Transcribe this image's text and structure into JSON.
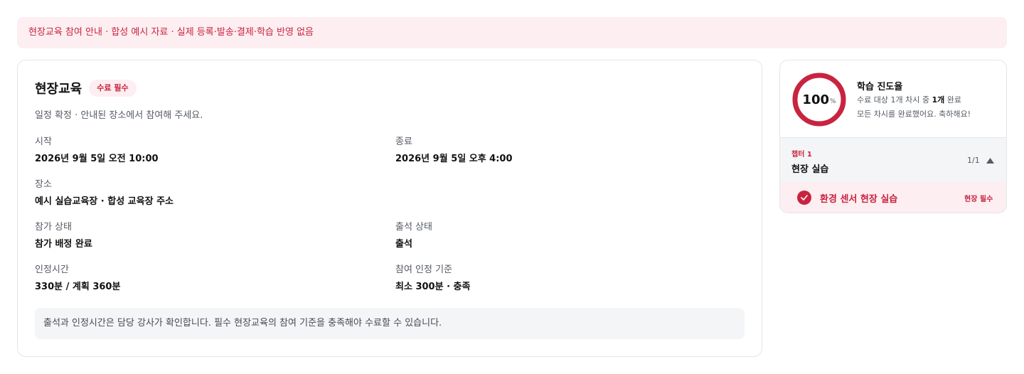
{
  "banner": {
    "text": "현장교육 참여 안내 · 합성 예시 자료 · 실제 등록·발송·결제·학습 반영 없음"
  },
  "session": {
    "title": "현장교육",
    "badge": "수료 필수",
    "subtitle": "일정 확정 · 안내된 장소에서 참여해 주세요.",
    "fields": {
      "start": {
        "label": "시작",
        "value": "2026년 9월 5일 오전 10:00"
      },
      "end": {
        "label": "종료",
        "value": "2026년 9월 5일 오후 4:00"
      },
      "location": {
        "label": "장소",
        "value": "예시 실습교육장 · 합성 교육장 주소"
      },
      "participation": {
        "label": "참가 상태",
        "value": "참가 배정 완료"
      },
      "attendance": {
        "label": "출석 상태",
        "value": "출석"
      },
      "credited_time": {
        "label": "인정시간",
        "value": "330분 / 계획 360분"
      },
      "criteria": {
        "label": "참여 인정 기준",
        "value": "최소 300분 · 충족"
      }
    },
    "note": "출석과 인정시간은 담당 강사가 확인합니다. 필수 현장교육의 참여 기준을 충족해야 수료할 수 있습니다."
  },
  "progress": {
    "percent": 100,
    "percent_label": "100",
    "unit": "%",
    "title": "학습 진도율",
    "summary_prefix": "수료 대상 1개 차시 중 ",
    "summary_bold": "1개",
    "summary_suffix": " 완료",
    "done_message": "모든 차시를 완료했어요. 축하해요!",
    "ring_color": "#c8243f",
    "track_color": "#f1d3d9"
  },
  "chapter": {
    "label": "챕터 1",
    "title": "현장 실습",
    "count": "1/1",
    "toggle_icon": "caret-up-icon",
    "lessons": [
      {
        "title": "환경 센서 현장 실습",
        "tag": "현장 필수",
        "status_icon": "check-circle-icon"
      }
    ]
  },
  "colors": {
    "accent": "#c8243f",
    "accent_bg": "#fdeef1",
    "muted_bg": "#f4f5f7"
  }
}
